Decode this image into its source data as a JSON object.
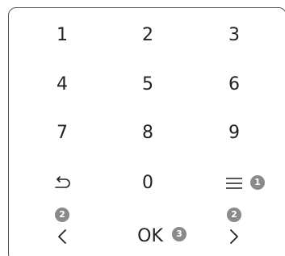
{
  "keypad": {
    "rows": [
      [
        "1",
        "2",
        "3"
      ],
      [
        "4",
        "5",
        "6"
      ],
      [
        "7",
        "8",
        "9"
      ]
    ],
    "zero": "0",
    "ok_label": "OK"
  },
  "icons": {
    "back": "back-arrow-icon",
    "menu": "menu-icon",
    "left": "chevron-left-icon",
    "right": "chevron-right-icon"
  },
  "callouts": {
    "menu": "1",
    "left": "2",
    "right": "2",
    "ok": "3"
  },
  "colors": {
    "text": "#222222",
    "frame": "#555555",
    "badge": "#8a8a8a"
  }
}
